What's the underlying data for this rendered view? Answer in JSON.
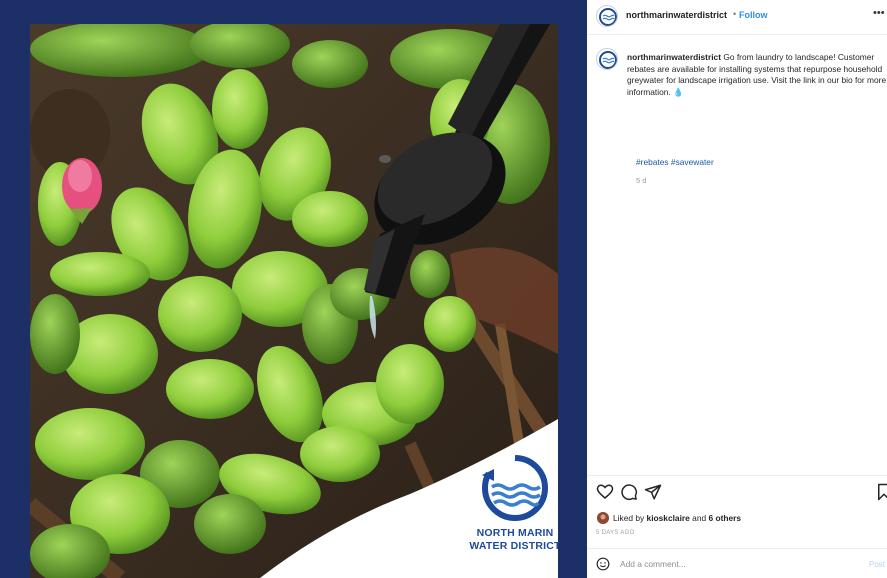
{
  "post": {
    "username": "northmarinwaterdistrict",
    "follow_label": "Follow",
    "dot": "•",
    "more_icon": "more-horizontal-icon",
    "caption": {
      "username": "northmarinwaterdistrict",
      "text": "Go from laundry to landscape! Customer rebates are available for installing systems that repurpose household greywater for landscape irrigation use. Visit the link in our bio for more information. 💧",
      "hashtags": "#rebates #savewater",
      "age": "5 d"
    },
    "likes": {
      "prefix": "Liked by",
      "user": "kioskclaire",
      "and": "and",
      "others": "6 others"
    },
    "post_age": "5 DAYS AGO",
    "comment": {
      "placeholder": "Add a comment...",
      "post_label": "Post"
    },
    "logo": {
      "line1": "NORTH MARIN",
      "line2": "WATER DISTRICT"
    }
  },
  "colors": {
    "frame": "#1c2f66",
    "brand_blue": "#1e4a9c",
    "link": "#2f8ce6",
    "hashtag": "#1d5aa8"
  }
}
